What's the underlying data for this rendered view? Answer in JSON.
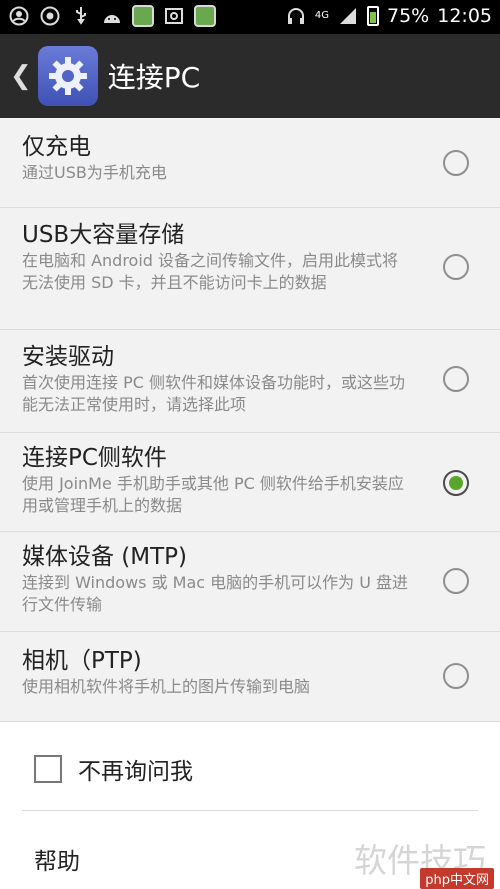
{
  "status_bar": {
    "battery": "75%",
    "time": "12:05",
    "network": "4G",
    "icons": [
      "account-circle-icon",
      "settings-circle-icon",
      "usb-icon",
      "android-icon",
      "app-icon",
      "image-icon",
      "app-icon",
      "headset-icon",
      "signal-icon",
      "battery-icon"
    ]
  },
  "header": {
    "title": "连接PC"
  },
  "options": [
    {
      "title": "仅充电",
      "desc": "通过USB为手机充电",
      "checked": false
    },
    {
      "title": "USB大容量存储",
      "desc": "在电脑和 Android 设备之间传输文件，启用此模式将无法使用 SD 卡，并且不能访问卡上的数据",
      "checked": false
    },
    {
      "title": "安装驱动",
      "desc": "首次使用连接 PC 侧软件和媒体设备功能时，或这些功能无法正常使用时，请选择此项",
      "checked": false
    },
    {
      "title": "连接PC侧软件",
      "desc": "使用 JoinMe 手机助手或其他 PC 侧软件给手机安装应用或管理手机上的数据",
      "checked": true
    },
    {
      "title": "媒体设备 (MTP)",
      "desc": "连接到 Windows 或 Mac 电脑的手机可以作为 U 盘进行文件传输",
      "checked": false
    },
    {
      "title": "相机（PTP)",
      "desc": "使用相机软件将手机上的图片传输到电脑",
      "checked": false
    }
  ],
  "dont_ask": {
    "label": "不再询问我",
    "checked": false
  },
  "help": {
    "label": "帮助"
  },
  "watermark": {
    "text": "软件技巧",
    "badge": "php中文网"
  },
  "colors": {
    "accent": "#5aa52b",
    "action_bar": "#2b2b2b"
  }
}
